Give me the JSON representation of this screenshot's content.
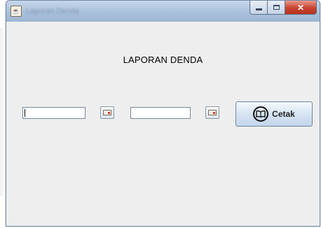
{
  "window": {
    "title": "Laporan Denda",
    "controls": {
      "minimize": "minimize",
      "maximize": "maximize",
      "close": "close"
    }
  },
  "heading": "LAPORAN DENDA",
  "date_from": {
    "value": ""
  },
  "date_to": {
    "value": ""
  },
  "print_button": {
    "label": "Cetak",
    "icon": "book-icon"
  }
}
